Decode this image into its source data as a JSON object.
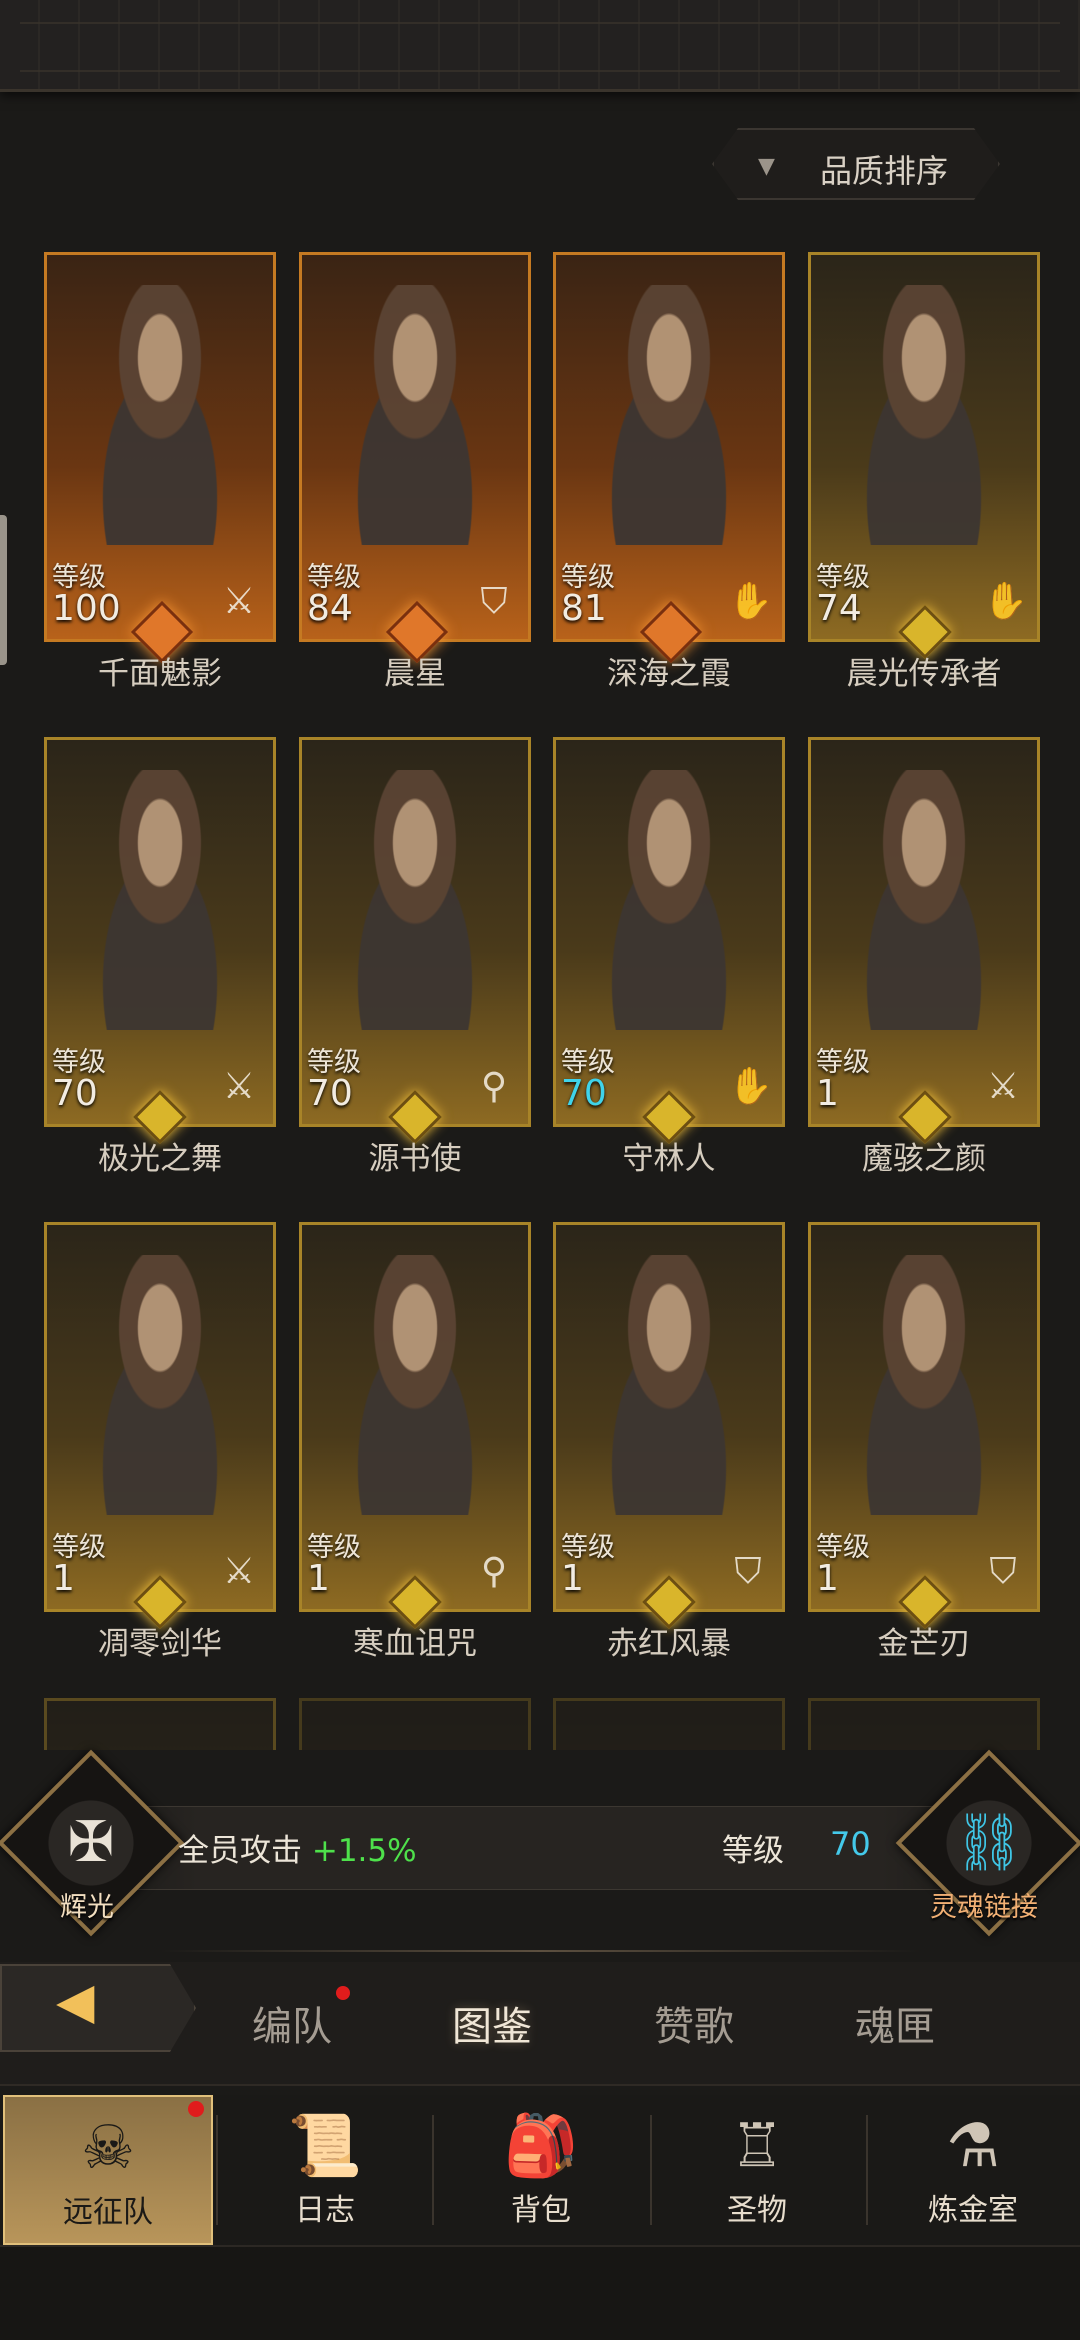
{
  "sort": {
    "label": "品质排序",
    "arrow": "▼"
  },
  "level_label": "等级",
  "heroes": [
    {
      "name": "千面魅影",
      "level": "100",
      "class_icon": "sword-icon",
      "frame": "orange"
    },
    {
      "name": "晨星",
      "level": "84",
      "class_icon": "shield-icon",
      "frame": "orange"
    },
    {
      "name": "深海之霞",
      "level": "81",
      "class_icon": "hand-icon",
      "frame": "orange"
    },
    {
      "name": "晨光传承者",
      "level": "74",
      "class_icon": "hand-icon",
      "frame": "gold"
    },
    {
      "name": "极光之舞",
      "level": "70",
      "class_icon": "sword-icon",
      "frame": "gold"
    },
    {
      "name": "源书使",
      "level": "70",
      "class_icon": "staff-icon",
      "frame": "gold"
    },
    {
      "name": "守林人",
      "level": "70",
      "class_icon": "hand-icon",
      "frame": "gold",
      "level_color": "cyan"
    },
    {
      "name": "魔骇之颜",
      "level": "1",
      "class_icon": "sword-icon",
      "frame": "gold"
    },
    {
      "name": "凋零剑华",
      "level": "1",
      "class_icon": "sword-icon",
      "frame": "gold"
    },
    {
      "name": "寒血诅咒",
      "level": "1",
      "class_icon": "staff-icon",
      "frame": "gold"
    },
    {
      "name": "赤红风暴",
      "level": "1",
      "class_icon": "shield-icon",
      "frame": "gold"
    },
    {
      "name": "金芒刃",
      "level": "1",
      "class_icon": "shield-icon",
      "frame": "gold"
    }
  ],
  "bonus": {
    "radiance_label": "辉光",
    "team_attack_label": "全员攻击",
    "team_attack_value": "+1.5%",
    "level_label": "等级",
    "level_value": "70",
    "soul_link_label": "灵魂链接"
  },
  "tabs": [
    {
      "label": "编队",
      "active": false,
      "has_dot": true
    },
    {
      "label": "图鉴",
      "active": true
    },
    {
      "label": "赞歌",
      "active": false
    },
    {
      "label": "魂匣",
      "active": false
    }
  ],
  "nav": [
    {
      "label": "远征队",
      "icon": "helmet-icon",
      "active": true,
      "has_dot": true
    },
    {
      "label": "日志",
      "icon": "scroll-icon"
    },
    {
      "label": "背包",
      "icon": "backpack-icon"
    },
    {
      "label": "圣物",
      "icon": "relic-icon"
    },
    {
      "label": "炼金室",
      "icon": "alchemy-icon"
    }
  ],
  "colors": {
    "accent_gold": "#d9b52b",
    "accent_orange": "#e0772a",
    "cyan": "#3fd3ea",
    "green": "#4ee14b",
    "red_dot": "#e01c1c"
  }
}
